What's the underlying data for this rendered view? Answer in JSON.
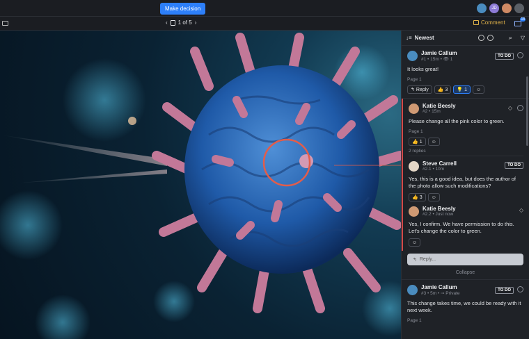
{
  "topbar": {
    "decision_label": "Make decision"
  },
  "avatars": [
    {
      "initials": "",
      "color": "#4a8cbf"
    },
    {
      "initials": "JD",
      "color": "#8d7bd6"
    },
    {
      "initials": "",
      "color": "#d08a64"
    },
    {
      "initials": "",
      "color": "#5a5f66"
    }
  ],
  "toolbar": {
    "page_indicator": "1 of 5",
    "comment_label": "Comment",
    "notif_count": "18"
  },
  "panel": {
    "sort_label": "Newest",
    "comments": [
      {
        "name": "Jamie Callum",
        "meta": "#1 • 15m • 👁 1",
        "text": "It looks great!",
        "page": "Page 1",
        "todo": "TO DO",
        "reply_label": "Reply",
        "thumbs_count": "3",
        "bulb_count": "1",
        "avatar_color": "#4a8cbf"
      }
    ],
    "thread": {
      "name": "Katie Beesly",
      "meta": "#2 • 15m",
      "text": "Please change all the pink color to green.",
      "page": "Page 1",
      "thumbs_count": "1",
      "replies_label": "2 replies",
      "avatar_color": "#d09a74",
      "replies": [
        {
          "name": "Steve Carrell",
          "meta": "#2.1 • 10m",
          "text": "Yes, this is a good idea, but does the author of the photo allow such modifications?",
          "todo": "TO DO",
          "thumbs_count": "3",
          "avatar_color": "#e4d7c7"
        },
        {
          "name": "Katie Beesly",
          "meta": "#2.2 • Just now",
          "text": "Yes, I confirm. We have permission to do this. Let's change the color to green.",
          "avatar_color": "#d09a74"
        }
      ],
      "reply_placeholder": "Reply...",
      "collapse_label": "Collapse"
    },
    "last": {
      "name": "Jamie Callum",
      "meta": "#3 • 5m • ⊸ Private",
      "text": "This change takes time, we could be ready with it next week.",
      "page": "Page 1",
      "todo": "TO DO",
      "avatar_color": "#4a8cbf"
    }
  },
  "colors": {
    "accent": "#2d7ff9",
    "annotation": "#e35d4a",
    "comment_accent": "#e0b24a"
  }
}
